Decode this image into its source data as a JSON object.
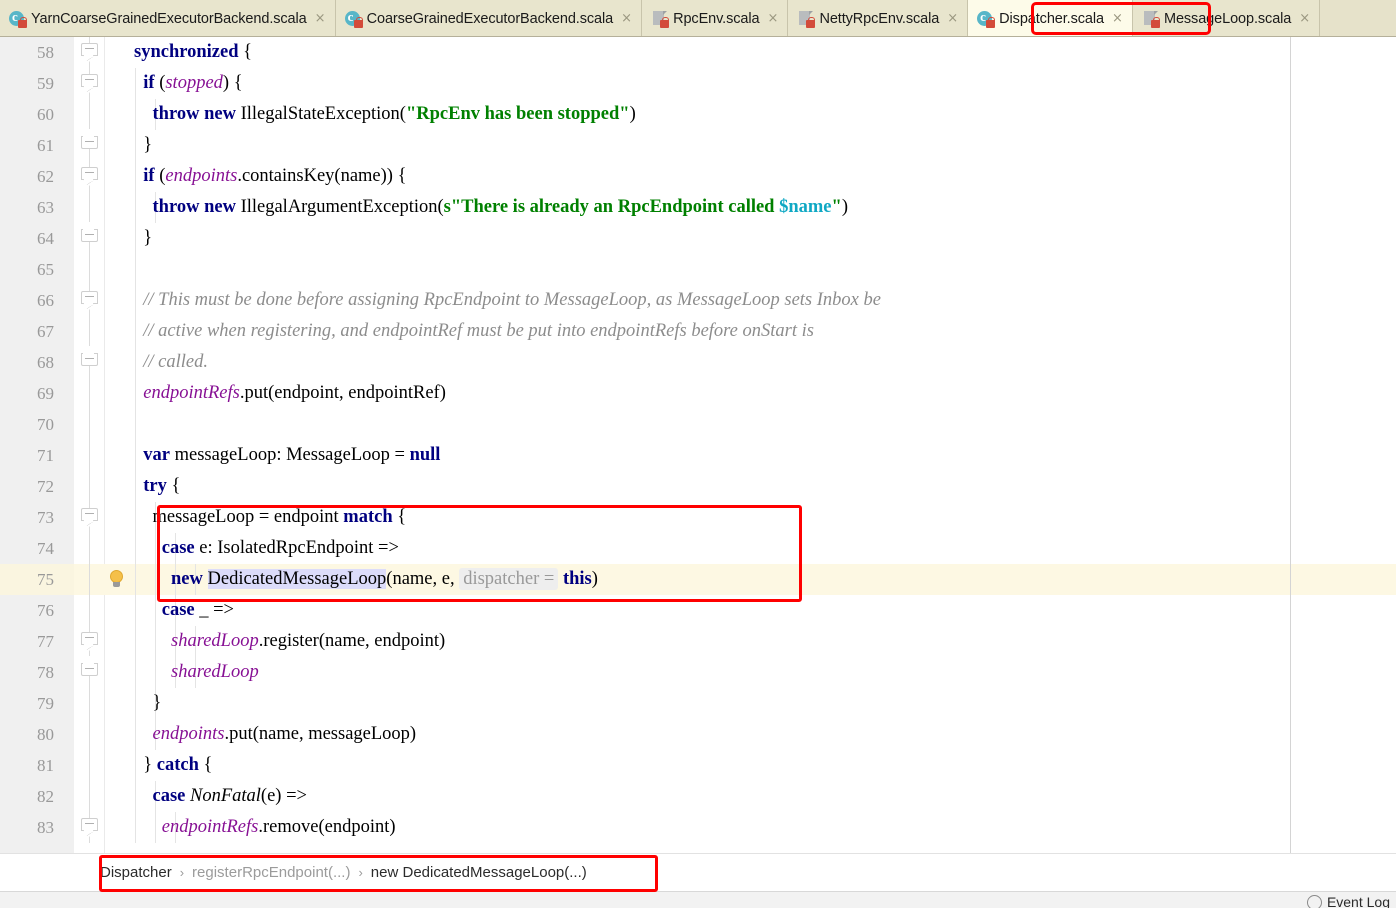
{
  "window": {
    "title": "Dispatcher.scala",
    "accent_red": "#ff0000",
    "caret_line_color": "#fdf8e3",
    "active_tab_bg": "#fdfbe9",
    "inactive_tab_bg": "#e8e5cd"
  },
  "tabs": [
    {
      "label": "YarnCoarseGrainedExecutorBackend.scala",
      "icon": "scala-class-icon",
      "active": false,
      "close": "×"
    },
    {
      "label": "CoarseGrainedExecutorBackend.scala",
      "icon": "scala-class-icon",
      "active": false,
      "close": "×"
    },
    {
      "label": "RpcEnv.scala",
      "icon": "scala-file-icon",
      "active": false,
      "close": "×"
    },
    {
      "label": "NettyRpcEnv.scala",
      "icon": "scala-file-icon",
      "active": false,
      "close": "×"
    },
    {
      "label": "Dispatcher.scala",
      "icon": "scala-class-icon",
      "active": true,
      "close": "×"
    },
    {
      "label": "MessageLoop.scala",
      "icon": "scala-file-icon",
      "active": false,
      "close": "×"
    }
  ],
  "editor": {
    "first_line": 58,
    "caret_line": 75,
    "lines": [
      {
        "n": 58,
        "fold": "open",
        "indent": 0,
        "text": "synchronized {"
      },
      {
        "n": 59,
        "fold": "open",
        "indent": 1,
        "text": "  if (stopped) {"
      },
      {
        "n": 60,
        "fold": "none",
        "indent": 2,
        "text": "    throw new IllegalStateException(\"RpcEnv has been stopped\")"
      },
      {
        "n": 61,
        "fold": "close",
        "indent": 1,
        "text": "  }"
      },
      {
        "n": 62,
        "fold": "open",
        "indent": 1,
        "text": "  if (endpoints.containsKey(name)) {"
      },
      {
        "n": 63,
        "fold": "none",
        "indent": 2,
        "text": "    throw new IllegalArgumentException(s\"There is already an RpcEndpoint called $name\")"
      },
      {
        "n": 64,
        "fold": "close",
        "indent": 1,
        "text": "  }"
      },
      {
        "n": 65,
        "fold": "none",
        "indent": 1,
        "text": ""
      },
      {
        "n": 66,
        "fold": "open",
        "indent": 1,
        "text": "  // This must be done before assigning RpcEndpoint to MessageLoop, as MessageLoop sets Inbox be"
      },
      {
        "n": 67,
        "fold": "none",
        "indent": 1,
        "text": "  // active when registering, and endpointRef must be put into endpointRefs before onStart is"
      },
      {
        "n": 68,
        "fold": "close",
        "indent": 1,
        "text": "  // called."
      },
      {
        "n": 69,
        "fold": "none",
        "indent": 1,
        "text": "  endpointRefs.put(endpoint, endpointRef)"
      },
      {
        "n": 70,
        "fold": "none",
        "indent": 1,
        "text": ""
      },
      {
        "n": 71,
        "fold": "none",
        "indent": 1,
        "text": "  var messageLoop: MessageLoop = null"
      },
      {
        "n": 72,
        "fold": "none",
        "indent": 1,
        "text": "  try {"
      },
      {
        "n": 73,
        "fold": "open",
        "indent": 2,
        "text": "    messageLoop = endpoint match {"
      },
      {
        "n": 74,
        "fold": "none",
        "indent": 3,
        "text": "      case e: IsolatedRpcEndpoint =>"
      },
      {
        "n": 75,
        "fold": "none",
        "indent": 4,
        "text": "        new DedicatedMessageLoop(name, e, dispatcher = this)"
      },
      {
        "n": 76,
        "fold": "none",
        "indent": 3,
        "text": "      case _ =>"
      },
      {
        "n": 77,
        "fold": "open",
        "indent": 4,
        "text": "        sharedLoop.register(name, endpoint)"
      },
      {
        "n": 78,
        "fold": "close",
        "indent": 4,
        "text": "        sharedLoop"
      },
      {
        "n": 79,
        "fold": "none",
        "indent": 2,
        "text": "    }"
      },
      {
        "n": 80,
        "fold": "none",
        "indent": 2,
        "text": "    endpoints.put(name, messageLoop)"
      },
      {
        "n": 81,
        "fold": "none",
        "indent": 1,
        "text": "  } catch {"
      },
      {
        "n": 82,
        "fold": "none",
        "indent": 2,
        "text": "    case NonFatal(e) =>"
      },
      {
        "n": 83,
        "fold": "open",
        "indent": 3,
        "text": "      endpointRefs.remove(endpoint)"
      }
    ],
    "intention_bulb_line": 75,
    "parameter_hint": "dispatcher =",
    "highlighted_identifier": "DedicatedMessageLoop"
  },
  "breadcrumb": {
    "separator": "›",
    "items": [
      {
        "label": "Dispatcher",
        "dim": false
      },
      {
        "label": "registerRpcEndpoint(...)",
        "dim": true
      },
      {
        "label": "new DedicatedMessageLoop(...)",
        "dim": false
      }
    ]
  },
  "status": {
    "event_log": "Event Log"
  }
}
